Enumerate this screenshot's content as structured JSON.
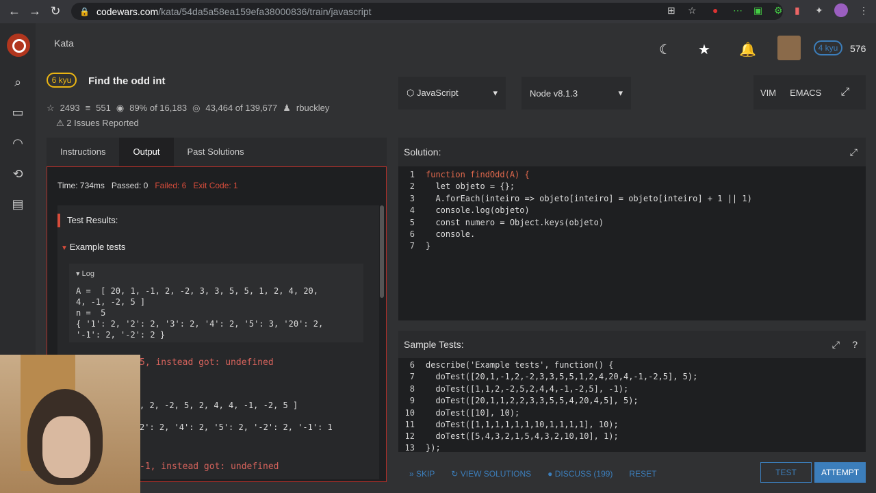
{
  "browser": {
    "url_domain": "codewars.com",
    "url_path": "/kata/54da5a58ea159efa38000836/train/javascript"
  },
  "header": {
    "section": "Kata",
    "rank_badge": "4 kyu",
    "honor": "576"
  },
  "kata": {
    "difficulty": "6 kyu",
    "title": "Find the odd int",
    "stars": "2493",
    "collections": "551",
    "satisfaction": "89% of 16,183",
    "completed": "43,464 of 139,677",
    "author": "rbuckley",
    "issues": "2 Issues Reported"
  },
  "tabs": {
    "instructions": "Instructions",
    "output": "Output",
    "past": "Past Solutions"
  },
  "output": {
    "time": "Time: 734ms",
    "passed": "Passed: 0",
    "failed": "Failed: 6",
    "exit": "Exit Code: 1",
    "test_results": "Test Results:",
    "example_tests": "Example tests",
    "log_label": "Log",
    "log_text": "A =  [ 20, 1, -1, 2, -2, 3, 3, 5, 5, 1, 2, 4, 20,\n4, -1, -2, 5 ]\nn =  5\n{ '1': 2, '2': 2, '3': 2, '4': 2, '5': 3, '20': 2,\n'-1': 2, '-2': 2 }",
    "expected1": "5, instead got: undefined",
    "partial1": ", 2, -2, 5, 2, 4, 4, -1, -2, 5 ]",
    "partial2": "2': 2, '4': 2, '5': 2, '-2': 2, '-1': 1",
    "expected2": "-1, instead got: undefined"
  },
  "selects": {
    "language": "JavaScript",
    "node": "Node v8.1.3"
  },
  "modes": {
    "vim": "VIM",
    "emacs": "EMACS"
  },
  "solution": {
    "title": "Solution:",
    "lines": [
      "function findOdd(A) {",
      "  let objeto = {};",
      "  A.forEach(inteiro => objeto[inteiro] = objeto[inteiro] + 1 || 1)",
      "  console.log(objeto)",
      "  const numero = Object.keys(objeto)",
      "  console.",
      "}"
    ]
  },
  "samples": {
    "title": "Sample Tests:",
    "line_numbers": [
      "6",
      "7",
      "8",
      "9",
      "10",
      "11",
      "12",
      "13"
    ],
    "lines": [
      "describe('Example tests', function() {",
      "  doTest([20,1,-1,2,-2,3,3,5,5,1,2,4,20,4,-1,-2,5], 5);",
      "  doTest([1,1,2,-2,5,2,4,4,-1,-2,5], -1);",
      "  doTest([20,1,1,2,2,3,3,5,5,4,20,4,5], 5);",
      "  doTest([10], 10);",
      "  doTest([1,1,1,1,1,1,10,1,1,1,1], 10);",
      "  doTest([5,4,3,2,1,5,4,3,2,10,10], 1);",
      "});"
    ]
  },
  "actions": {
    "skip": "SKIP",
    "view_solutions": "VIEW SOLUTIONS",
    "discuss": "DISCUSS (199)",
    "reset": "RESET",
    "test": "TEST",
    "attempt": "ATTEMPT"
  }
}
